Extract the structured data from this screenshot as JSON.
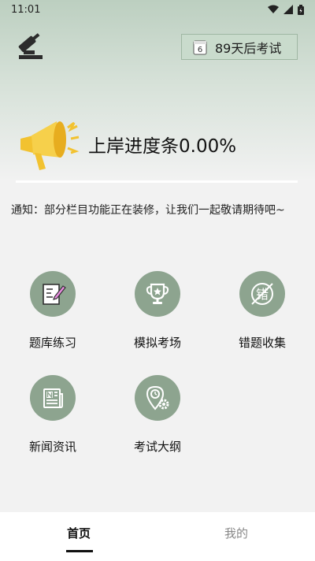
{
  "status": {
    "time": "11:01"
  },
  "header": {
    "exam_countdown": "89天后考试",
    "calendar_day": "6"
  },
  "progress": {
    "label": "上岸进度条0.00%"
  },
  "notice": {
    "text": "通知：部分栏目功能正在装修，让我们一起敬请期待吧~"
  },
  "menu": {
    "items": [
      {
        "label": "题库练习",
        "icon": "notebook-pencil-icon"
      },
      {
        "label": "模拟考场",
        "icon": "trophy-icon"
      },
      {
        "label": "错题收集",
        "icon": "wrong-questions-icon",
        "icon_text": "错"
      },
      {
        "label": "新闻资讯",
        "icon": "news-icon"
      },
      {
        "label": "考试大纲",
        "icon": "location-gear-icon"
      }
    ]
  },
  "nav": {
    "home": "首页",
    "mine": "我的"
  },
  "colors": {
    "accent": "#8da48f",
    "header_bg": "#c9dbcc",
    "megaphone": "#f2c230"
  }
}
